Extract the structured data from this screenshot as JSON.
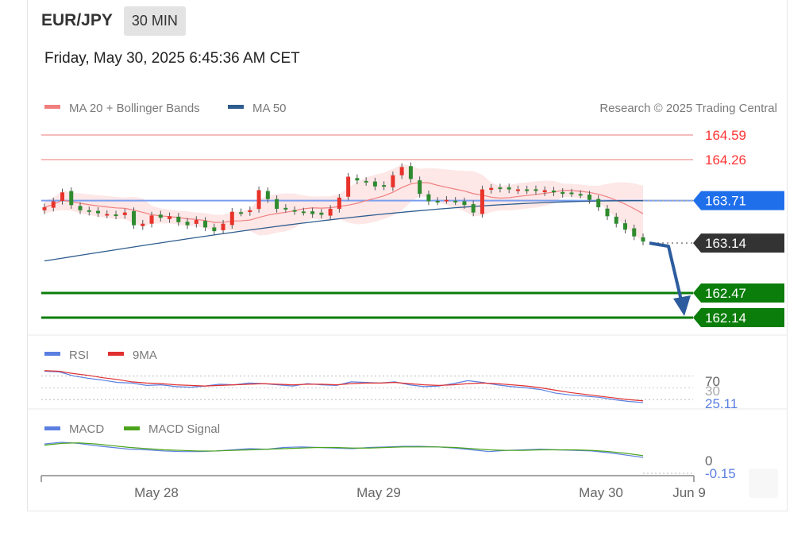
{
  "header": {
    "pair": "EUR/JPY",
    "timeframe": "30 MIN",
    "datetime": "Friday, May 30, 2025 6:45:36 AM CET"
  },
  "legend_main": {
    "ma20": "MA 20 + Bollinger Bands",
    "ma50": "MA 50",
    "credit": "Research © 2025 Trading Central"
  },
  "legend_rsi": {
    "rsi": "RSI",
    "ma": "9MA"
  },
  "legend_macd": {
    "macd": "MACD",
    "signal": "MACD Signal"
  },
  "colors": {
    "ma20": "#f08080",
    "ma50": "#2d5c8e",
    "resistance": "#ff3333",
    "pivot": "#1f6feb",
    "support": "#0a7d0a",
    "current": "#333333",
    "up": "#e8332b",
    "down": "#2e8b2e",
    "rsi": "#5b7fe0",
    "rsi_ma": "#e03030",
    "macd": "#5b7fe0",
    "macd_signal": "#4aa31a",
    "arrow": "#2d5c9e"
  },
  "chart_data": {
    "type": "candlestick",
    "y_range": [
      161.95,
      164.72
    ],
    "levels": {
      "resistances": [
        "164.59",
        "164.26"
      ],
      "pivot": "163.71",
      "current": "163.14",
      "supports": [
        "162.47",
        "162.14"
      ]
    },
    "x_labels": [
      "May 28",
      "May 29",
      "May 30",
      "Jun 9"
    ],
    "price_path": [
      163.62,
      163.7,
      163.82,
      163.65,
      163.58,
      163.56,
      163.54,
      163.53,
      163.51,
      163.55,
      163.38,
      163.4,
      163.51,
      163.48,
      163.5,
      163.42,
      163.38,
      163.45,
      163.35,
      163.3,
      163.4,
      163.56,
      163.55,
      163.58,
      163.85,
      163.73,
      163.6,
      163.6,
      163.57,
      163.56,
      163.53,
      163.52,
      163.6,
      163.75,
      164.03,
      163.98,
      163.96,
      163.9,
      163.9,
      164.05,
      164.16,
      164.0,
      163.8,
      163.7,
      163.7,
      163.72,
      163.7,
      163.65,
      163.55,
      163.86,
      163.88,
      163.87,
      163.86,
      163.86,
      163.85,
      163.84,
      163.85,
      163.82,
      163.8,
      163.81,
      163.79,
      163.72,
      163.62,
      163.5,
      163.4,
      163.32,
      163.23,
      163.16
    ],
    "ma50_start": 162.9,
    "ma50_end": 163.71,
    "forecast": {
      "from": 163.14,
      "to": 162.14
    },
    "rsi": {
      "labels": [
        "70",
        "30",
        "25.11"
      ],
      "values": [
        78,
        77,
        70,
        66,
        63,
        59,
        58,
        54,
        55,
        52,
        51,
        53,
        56,
        55,
        58,
        57,
        55,
        53,
        57,
        55,
        54,
        60,
        59,
        58,
        60,
        55,
        52,
        53,
        57,
        62,
        59,
        55,
        52,
        50,
        47,
        41,
        38,
        36,
        34,
        30,
        27,
        25.11
      ],
      "ma_values": [
        79,
        78,
        74,
        71,
        67,
        64,
        60,
        58,
        57,
        55,
        54,
        53,
        54,
        55,
        56,
        57,
        56,
        55,
        56,
        56,
        55,
        57,
        58,
        58,
        59,
        57,
        55,
        54,
        55,
        57,
        58,
        57,
        55,
        53,
        50,
        46,
        42,
        39,
        36,
        33,
        30,
        28
      ]
    },
    "macd": {
      "labels": [
        "0",
        "-0.15"
      ],
      "values": [
        0.08,
        0.11,
        0.09,
        0.05,
        0.02,
        -0.01,
        -0.02,
        -0.04,
        -0.05,
        -0.05,
        -0.04,
        -0.02,
        0.0,
        -0.01,
        0.02,
        0.03,
        0.02,
        0.01,
        0.0,
        0.02,
        0.03,
        0.04,
        0.04,
        0.03,
        0.01,
        -0.02,
        -0.05,
        -0.03,
        -0.02,
        -0.01,
        -0.02,
        -0.03,
        -0.04,
        -0.07,
        -0.11,
        -0.15
      ],
      "signal": [
        0.06,
        0.09,
        0.1,
        0.08,
        0.05,
        0.02,
        0.0,
        -0.02,
        -0.03,
        -0.04,
        -0.04,
        -0.03,
        -0.02,
        -0.01,
        0.0,
        0.01,
        0.02,
        0.02,
        0.01,
        0.01,
        0.02,
        0.03,
        0.03,
        0.03,
        0.02,
        0.0,
        -0.02,
        -0.03,
        -0.03,
        -0.02,
        -0.02,
        -0.02,
        -0.03,
        -0.05,
        -0.08,
        -0.12
      ]
    }
  }
}
